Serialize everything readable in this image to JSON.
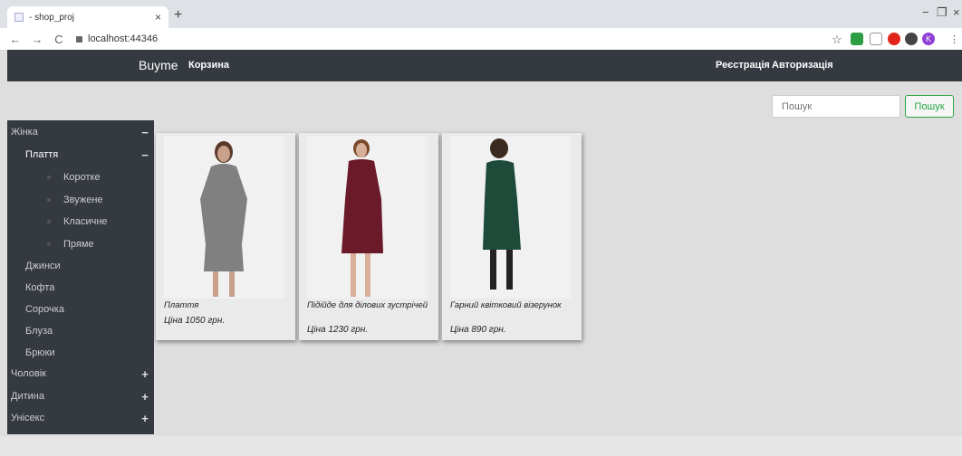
{
  "browser": {
    "tab_title": "- shop_proj",
    "tab_close": "×",
    "new_tab": "+",
    "url": "localhost:44346",
    "controls": {
      "minimize": "−",
      "restore": "❐",
      "close": "×"
    },
    "nav": {
      "back": "←",
      "forward": "→",
      "reload": "C"
    },
    "star_icon": "☆",
    "profile_initial": "K"
  },
  "navbar": {
    "brand": "Buyme",
    "cart": "Корзина",
    "register": "Реєстрація",
    "login": "Авторизація"
  },
  "search": {
    "placeholder": "Пошук",
    "button": "Пошук"
  },
  "sidebar": {
    "women": "Жінка",
    "dresses": "Плаття",
    "dress_short": "Коротке",
    "dress_narrow": "Звужене",
    "dress_classic": "Класичне",
    "dress_straight": "Пряме",
    "jeans": "Джинси",
    "sweater": "Кофта",
    "shirt": "Сорочка",
    "blouse": "Блуза",
    "trousers": "Брюки",
    "men": "Чоловік",
    "kids": "Дитина",
    "unisex": "Унісекс",
    "minus": "−",
    "plus": "+"
  },
  "products": [
    {
      "name": "Плаття",
      "price": "Ціна 1050 грн.",
      "dress_color": "#7b7b7b"
    },
    {
      "name": "Підійде для ділових зустрічей",
      "price": "Ціна 1230 грн.",
      "dress_color": "#6b1a2a"
    },
    {
      "name": "Гарний квітковий візерунок",
      "price": "Ціна 890 грн.",
      "dress_color": "#1e4a3a"
    }
  ]
}
